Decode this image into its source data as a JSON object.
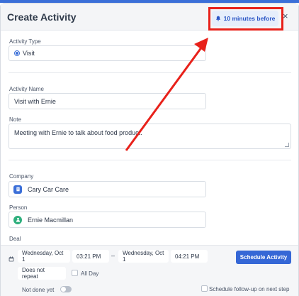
{
  "header": {
    "title": "Create Activity",
    "reminder_label": "10 minutes before",
    "close_glyph": "×"
  },
  "activity_type": {
    "label": "Activity Type",
    "value": "Visit"
  },
  "activity_name": {
    "label": "Activity Name",
    "value": "Visit with Ernie"
  },
  "note": {
    "label": "Note",
    "value": "Meeting with Ernie to talk about food product."
  },
  "company": {
    "label": "Company",
    "value": "Cary Car Care",
    "icon": "building-icon",
    "icon_color": "#3b6fd8"
  },
  "person": {
    "label": "Person",
    "value": "Ernie Macmillan",
    "icon": "person-icon",
    "icon_color": "#2eaf7d"
  },
  "deal": {
    "label": "Deal"
  },
  "footer": {
    "start_date": "Wednesday, Oct 1",
    "start_time": "03:21 PM",
    "separator": "–",
    "end_date": "Wednesday, Oct 1",
    "end_time": "04:21 PM",
    "schedule_button": "Schedule Activity",
    "repeat": "Does not repeat",
    "all_day": "All Day",
    "not_done": "Not done yet",
    "follow_up": "Schedule follow-up on next step"
  },
  "annotation": {
    "color": "#e8211a"
  }
}
